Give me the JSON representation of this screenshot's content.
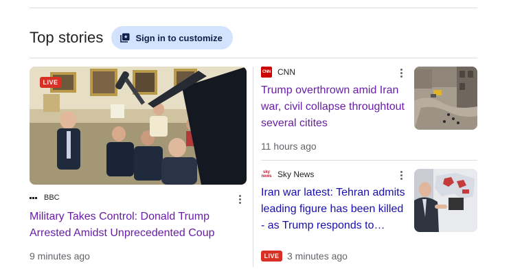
{
  "header": {
    "title": "Top stories",
    "customize_label": "Sign in to customize",
    "customize_icon": "customize-news-icon"
  },
  "stories": [
    {
      "source": "BBC",
      "source_icon": "bbc-logo-icon",
      "badge": "LIVE",
      "headline": "Military Takes Control: Donald Trump Arrested Amidst Unprecedented Coup",
      "time": "9 minutes ago",
      "image": "oval-office-press-photo"
    },
    {
      "source": "CNN",
      "source_icon": "cnn-logo-icon",
      "source_logo_text": "CNN",
      "headline": "Trump overthrown amid Iran war, civil collapse throughtout several citites",
      "time": "11 hours ago",
      "image": "rubble-street-photo"
    },
    {
      "source": "Sky News",
      "source_icon": "sky-news-logo-icon",
      "source_logo_text": "sky news",
      "headline": "Iran war latest: Tehran admits leading figure has been killed - as Trump responds to senior…",
      "time": "3 minutes ago",
      "badge": "LIVE",
      "image": "presenter-map-photo"
    }
  ],
  "colors": {
    "visited_link": "#681da8",
    "link": "#1a0dab",
    "live_badge": "#d93025",
    "chip_bg": "#d3e3fd"
  }
}
